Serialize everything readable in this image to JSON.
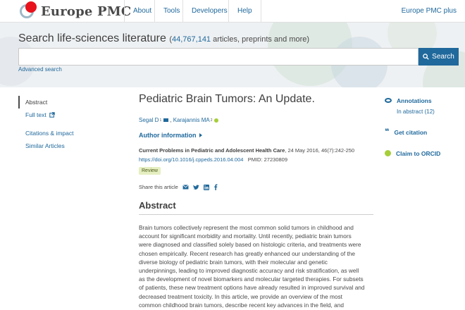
{
  "header": {
    "logo_text": "Europe PMC",
    "nav": {
      "about": "About",
      "tools": "Tools",
      "developers": "Developers",
      "help": "Help"
    },
    "plus": "Europe PMC plus"
  },
  "search": {
    "title": "Search life-sciences literature",
    "count_open": "(",
    "count_num": "44,767,141",
    "count_text": " articles, preprints and more)",
    "placeholder": "",
    "button": "Search",
    "advanced": "Advanced search"
  },
  "leftnav": {
    "abstract": "Abstract",
    "full_text": "Full text",
    "citations": "Citations & impact",
    "similar": "Similar Articles"
  },
  "article": {
    "title": "Pediatric Brain Tumors: An Update.",
    "author1": "Segal D",
    "author1_sup": "1",
    "author2": "Karajannis MA",
    "author2_sup": "2",
    "author_info": "Author information",
    "journal": "Current Problems in Pediatric and Adolescent Health Care",
    "date_vol": ", 24 May 2016, 46(7):242-250",
    "doi": "https://doi.org/10.1016/j.cppeds.2016.04.004",
    "pmid": "PMID: 27230809",
    "badge": "Review",
    "share_label": "Share this article",
    "abstract_heading": "Abstract",
    "abstract_text": "Brain tumors collectively represent the most common solid tumors in childhood and account for significant morbidity and mortality. Until recently, pediatric brain tumors were diagnosed and classified solely based on histologic criteria, and treatments were chosen empirically. Recent research has greatly enhanced our understanding of the diverse biology of pediatric brain tumors, with their molecular and genetic underpinnings, leading to improved diagnostic accuracy and risk stratification, as well as the development of novel biomarkers and molecular targeted therapies. For subsets of patients, these new treatment options have already resulted in improved survival and decreased treatment toxicity. In this article, we provide an overview of the most common childhood brain tumors, describe recent key advances in the field, and"
  },
  "rightbar": {
    "annotations": "Annotations",
    "annotations_sub": "In abstract (12)",
    "citation": "Get citation",
    "orcid": "Claim to ORCID"
  },
  "colors": {
    "link": "#20699c",
    "brand_red": "#e8121d",
    "orcid_green": "#a6ce39"
  }
}
